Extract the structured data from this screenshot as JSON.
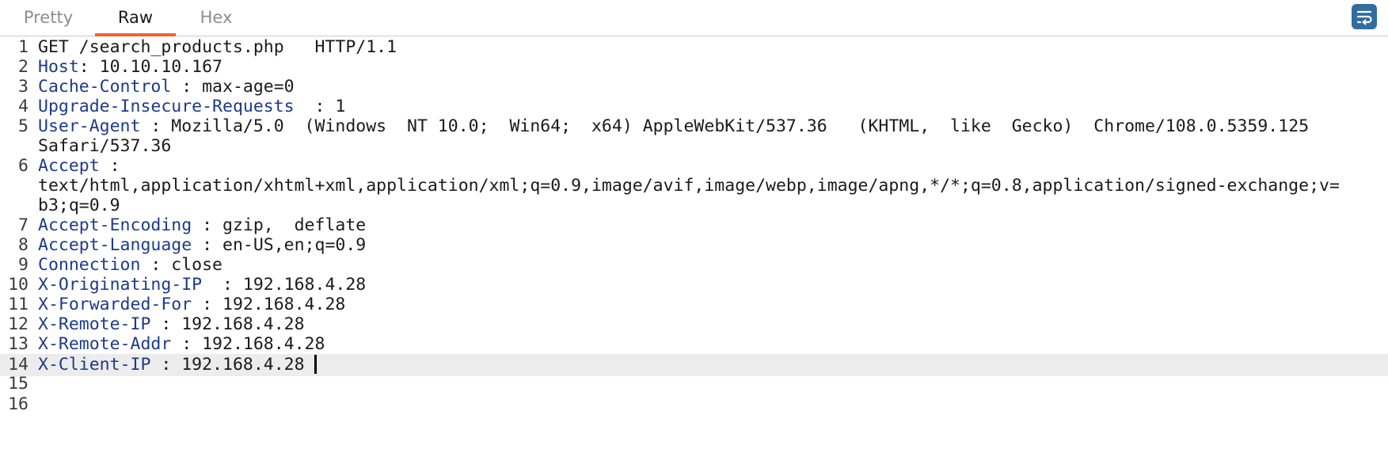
{
  "tabs": {
    "pretty": "Pretty",
    "raw": "Raw",
    "hex": "Hex",
    "active": "Raw"
  },
  "toolbar": {
    "wrap_icon": "wrap-lines-icon"
  },
  "colors": {
    "tab_accent": "#e8643c",
    "header_name": "#1c3a8c",
    "wrap_button": "#2f6da3"
  },
  "request": {
    "lines": [
      {
        "num": "1",
        "text": "GET /search_products.php   HTTP/1.1"
      },
      {
        "num": "2",
        "name": "Host",
        "rest": ": 10.10.10.167"
      },
      {
        "num": "3",
        "name": "Cache-Control",
        "rest": " : max-age=0"
      },
      {
        "num": "4",
        "name": "Upgrade-Insecure-Requests",
        "rest": "  : 1"
      },
      {
        "num": "5",
        "name": "User-Agent",
        "rest": " : Mozilla/5.0  (Windows  NT 10.0;  Win64;  x64) AppleWebKit/537.36   (KHTML,  like  Gecko)  Chrome/108.0.5359.125"
      },
      {
        "num": "",
        "text": "Safari/537.36"
      },
      {
        "num": "6",
        "name": "Accept",
        "rest": " :"
      },
      {
        "num": "",
        "text": "text/html,application/xhtml+xml,application/xml;q=0.9,image/avif,image/webp,image/apng,*/*;q=0.8,application/signed-exchange;v="
      },
      {
        "num": "",
        "text": "b3;q=0.9"
      },
      {
        "num": "7",
        "name": "Accept-Encoding",
        "rest": " : gzip,  deflate"
      },
      {
        "num": "8",
        "name": "Accept-Language",
        "rest": " : en-US,en;q=0.9"
      },
      {
        "num": "9",
        "name": "Connection",
        "rest": " : close"
      },
      {
        "num": "10",
        "name": "X-Originating-IP",
        "rest": "  : 192.168.4.28"
      },
      {
        "num": "11",
        "name": "X-Forwarded-For",
        "rest": " : 192.168.4.28"
      },
      {
        "num": "12",
        "name": "X-Remote-IP",
        "rest": " : 192.168.4.28"
      },
      {
        "num": "13",
        "name": "X-Remote-Addr",
        "rest": " : 192.168.4.28"
      },
      {
        "num": "14",
        "name": "X-Client-IP",
        "rest": " : 192.168.4.28",
        "current": true
      },
      {
        "num": "15",
        "text": ""
      },
      {
        "num": "16",
        "text": ""
      }
    ]
  }
}
